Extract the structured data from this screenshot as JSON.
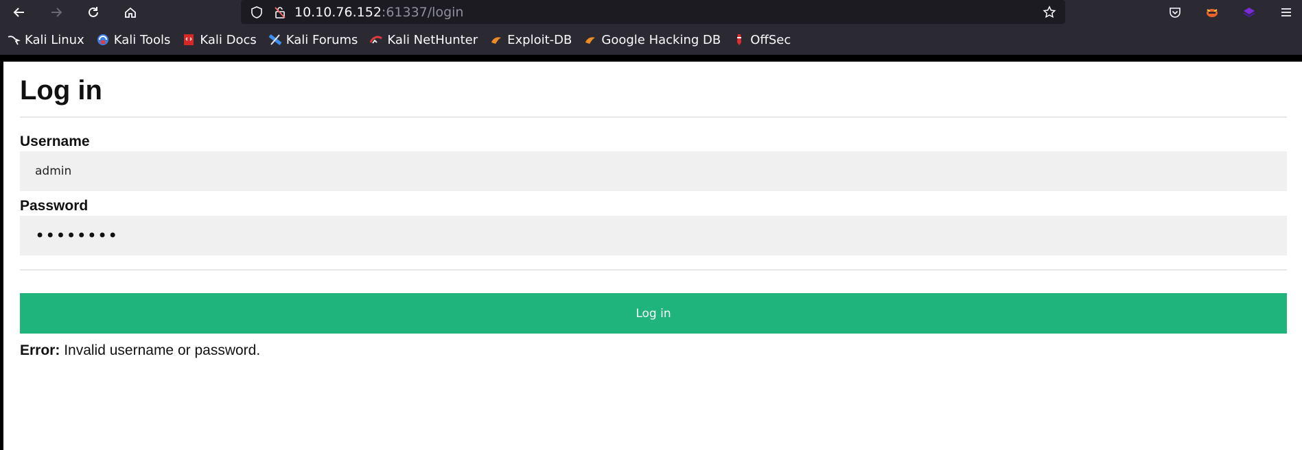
{
  "browser": {
    "url_host": "10.10.76.152",
    "url_path": ":61337/login",
    "bookmarks": [
      {
        "label": "Kali Linux",
        "icon": "kali-dragon-icon"
      },
      {
        "label": "Kali Tools",
        "icon": "kali-tools-icon"
      },
      {
        "label": "Kali Docs",
        "icon": "kali-docs-icon"
      },
      {
        "label": "Kali Forums",
        "icon": "kali-forums-icon"
      },
      {
        "label": "Kali NetHunter",
        "icon": "nethunter-icon"
      },
      {
        "label": "Exploit-DB",
        "icon": "exploit-db-icon"
      },
      {
        "label": "Google Hacking DB",
        "icon": "ghdb-icon"
      },
      {
        "label": "OffSec",
        "icon": "offsec-icon"
      }
    ]
  },
  "page": {
    "title": "Log in",
    "username_label": "Username",
    "username_value": "admin",
    "password_label": "Password",
    "password_masked": "••••••••",
    "submit_label": "Log in",
    "error_prefix": "Error:",
    "error_message": " Invalid username or password."
  },
  "colors": {
    "button_bg": "#1fb47b",
    "input_bg": "#f0f0f0",
    "chrome_bg": "#2b2a33"
  }
}
